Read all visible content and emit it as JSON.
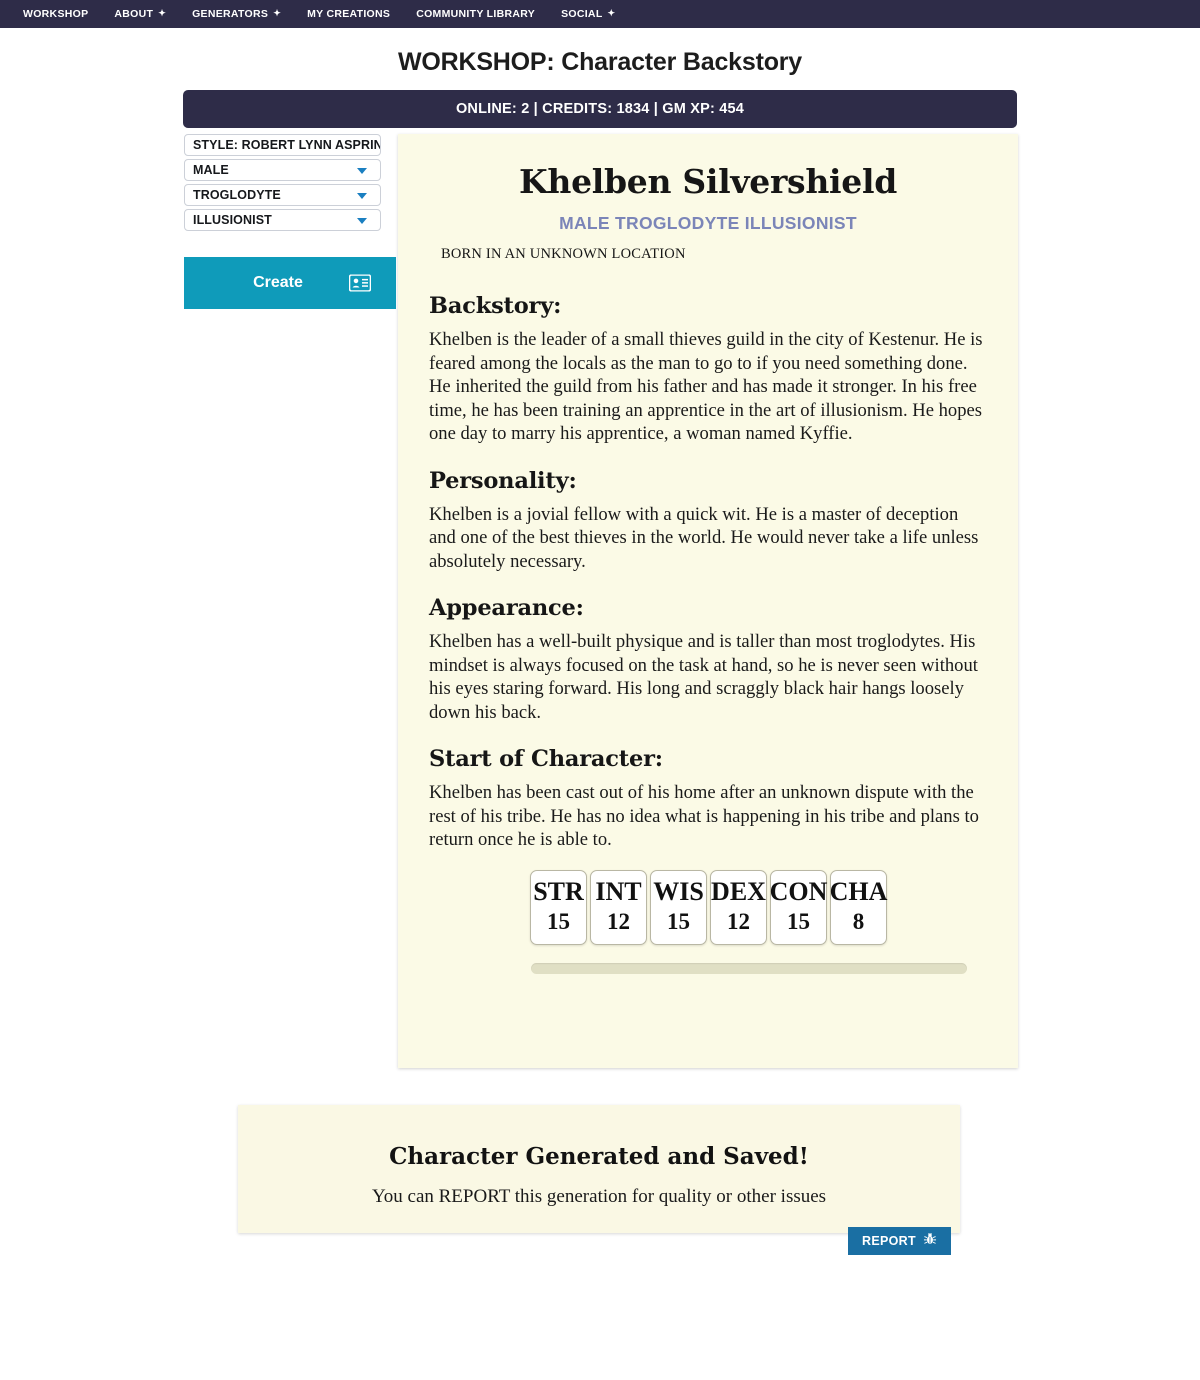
{
  "nav": {
    "items": [
      {
        "label": "WORKSHOP",
        "caret": false
      },
      {
        "label": "ABOUT",
        "caret": true
      },
      {
        "label": "GENERATORS",
        "caret": true
      },
      {
        "label": "MY CREATIONS",
        "caret": false
      },
      {
        "label": "COMMUNITY LIBRARY",
        "caret": false
      },
      {
        "label": "SOCIAL",
        "caret": true
      }
    ],
    "caret_glyph": "✦"
  },
  "header": {
    "title": "WORKSHOP: Character Backstory"
  },
  "status": {
    "text": "ONLINE: 2 | CREDITS: 1834 | GM XP: 454",
    "online": "2",
    "credits": "1834",
    "gm_xp": "454"
  },
  "sidebar": {
    "style_input": {
      "value": "STYLE: ROBERT LYNN ASPRIN",
      "placeholder": "STYLE:"
    },
    "selects": [
      {
        "name": "gender",
        "value": "MALE"
      },
      {
        "name": "race",
        "value": "TROGLODYTE"
      },
      {
        "name": "class",
        "value": "ILLUSIONIST"
      }
    ],
    "create_button": {
      "label": "Create",
      "icon": "id-card-icon"
    }
  },
  "character": {
    "name": "Khelben Silvershield",
    "subtitle": "MALE TROGLODYTE ILLUSIONIST",
    "birthplace": "BORN IN AN UNKNOWN LOCATION",
    "sections": [
      {
        "heading": "Backstory:",
        "text": "Khelben is the leader of a small thieves guild in the city of Kestenur. He is feared among the locals as the man to go to if you need something done. He inherited the guild from his father and has made it stronger. In his free time, he has been training an apprentice in the art of illusionism. He hopes one day to marry his apprentice, a woman named Kyffie."
      },
      {
        "heading": "Personality:",
        "text": "Khelben is a jovial fellow with a quick wit. He is a master of deception and one of the best thieves in the world. He would never take a life unless absolutely necessary."
      },
      {
        "heading": "Appearance:",
        "text": "Khelben has a well-built physique and is taller than most troglodytes. His mindset is always focused on the task at hand, so he is never seen without his eyes staring forward. His long and scraggly black hair hangs loosely down his back."
      },
      {
        "heading": "Start of Character:",
        "text": "Khelben has been cast out of his home after an unknown dispute with the rest of his tribe. He has no idea what is happening in his tribe and plans to return once he is able to."
      }
    ],
    "stats": [
      {
        "label": "STR",
        "value": "15"
      },
      {
        "label": "INT",
        "value": "12"
      },
      {
        "label": "WIS",
        "value": "15"
      },
      {
        "label": "DEX",
        "value": "12"
      },
      {
        "label": "CON",
        "value": "15"
      },
      {
        "label": "CHA",
        "value": "8"
      }
    ]
  },
  "notice": {
    "title": "Character Generated and Saved!",
    "subtitle": "You can REPORT this generation for quality or other issues",
    "report_button": {
      "label": "REPORT",
      "icon": "bug-icon"
    }
  },
  "colors": {
    "navy": "#2e2c48",
    "teal": "#0f9bba",
    "steel_blue": "#1a6fa3",
    "parchment": "#fbfae6",
    "subtitle_blue": "#7b85b8"
  }
}
